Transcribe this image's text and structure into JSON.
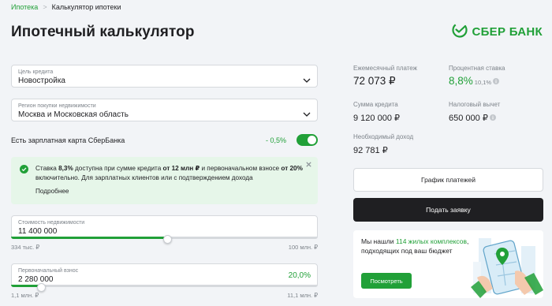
{
  "breadcrumb": {
    "home": "Ипотека",
    "separator": ">",
    "current": "Калькулятор ипотеки"
  },
  "page": {
    "title": "Ипотечный калькулятор"
  },
  "logo": {
    "text": "СБЕР БАНК"
  },
  "colors": {
    "brand_green": "#21a038",
    "dark": "#1f1f22",
    "info_bg": "#e6f6e9"
  },
  "form": {
    "goal": {
      "label": "Цель кредита",
      "value": "Новостройка"
    },
    "region": {
      "label": "Регион покупки недвижимости",
      "value": "Москва и Московская область"
    },
    "salary": {
      "label": "Есть зарплатная карта СберБанка",
      "discount": "- 0,5%",
      "enabled": true
    },
    "info": {
      "t1": "Ставка ",
      "rate": "8,3%",
      "t2": " доступна при сумме кредита ",
      "amount": "от 12 млн ₽",
      "t3": " и первоначальном взносе ",
      "down": "от 20%",
      "t4": " включительно. Для зарплатных клиентов или с подтверждением дохода",
      "more": "Подробнее"
    },
    "price": {
      "label": "Стоимость недвижимости",
      "value": "11 400 000",
      "min": "334 тыс. ₽",
      "max": "100 млн. ₽",
      "position": 0.51
    },
    "down_payment": {
      "label": "Первоначальный взнос",
      "value": "2 280 000",
      "percent": "20,0%",
      "min": "1,1 млн. ₽",
      "max": "11,1 млн. ₽",
      "position": 0.1
    }
  },
  "results": {
    "monthly": {
      "label": "Ежемесячный платеж",
      "value": "72 073 ₽"
    },
    "rate": {
      "label": "Процентная ставка",
      "value": "8,8%",
      "old": "10,1%"
    },
    "loan": {
      "label": "Сумма кредита",
      "value": "9 120 000 ₽"
    },
    "tax": {
      "label": "Налоговый вычет",
      "value": "650 000 ₽"
    },
    "income": {
      "label": "Необходимый доход",
      "value": "92 781 ₽"
    }
  },
  "actions": {
    "schedule": "График платежей",
    "apply": "Подать заявку"
  },
  "promo": {
    "t1": "Мы нашли ",
    "highlight": "114 жилых комплексов",
    "t2": ", подходящих под ваш бюджет",
    "button": "Посмотреть"
  },
  "icons": [
    "chevron-down-icon",
    "check-circle-icon",
    "close-icon",
    "info-icon",
    "sber-logo-icon"
  ]
}
